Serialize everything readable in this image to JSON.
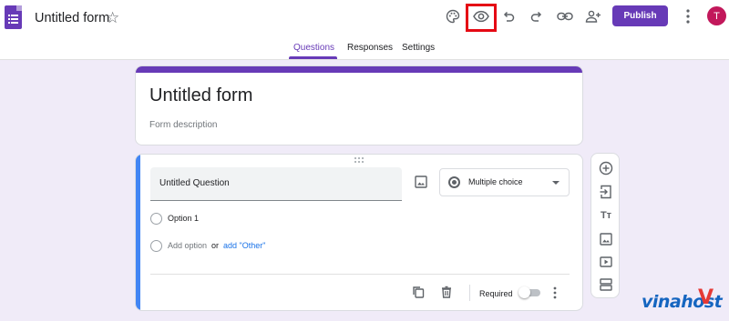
{
  "header": {
    "form_title": "Untitled form",
    "toolbar_icons": [
      "palette-icon",
      "preview-eye-icon",
      "undo-icon",
      "redo-icon",
      "link-icon",
      "add-collaborator-icon"
    ],
    "publish_label": "Publish",
    "avatar_initial": "T"
  },
  "tabs": [
    {
      "label": "Questions",
      "active": true
    },
    {
      "label": "Responses",
      "active": false
    },
    {
      "label": "Settings",
      "active": false
    }
  ],
  "form_header": {
    "title": "Untitled form",
    "description_placeholder": "Form description"
  },
  "question": {
    "title": "Untitled Question",
    "type": "Multiple choice",
    "options": [
      "Option 1"
    ],
    "add_option": "Add option",
    "or_text": "or",
    "add_other": "add \"Other\"",
    "required_label": "Required",
    "required": false
  },
  "side_toolbar": {
    "icons": [
      "add-question-icon",
      "import-questions-icon",
      "add-title-icon",
      "add-image-icon",
      "add-video-icon",
      "add-section-icon"
    ]
  },
  "watermark": {
    "text": "vinahost",
    "mark": "V"
  },
  "colors": {
    "accent": "#673ab7",
    "background": "#f0ebf8",
    "question_accent": "#4285f4",
    "highlight": "#e50914",
    "link": "#1a73e8"
  }
}
